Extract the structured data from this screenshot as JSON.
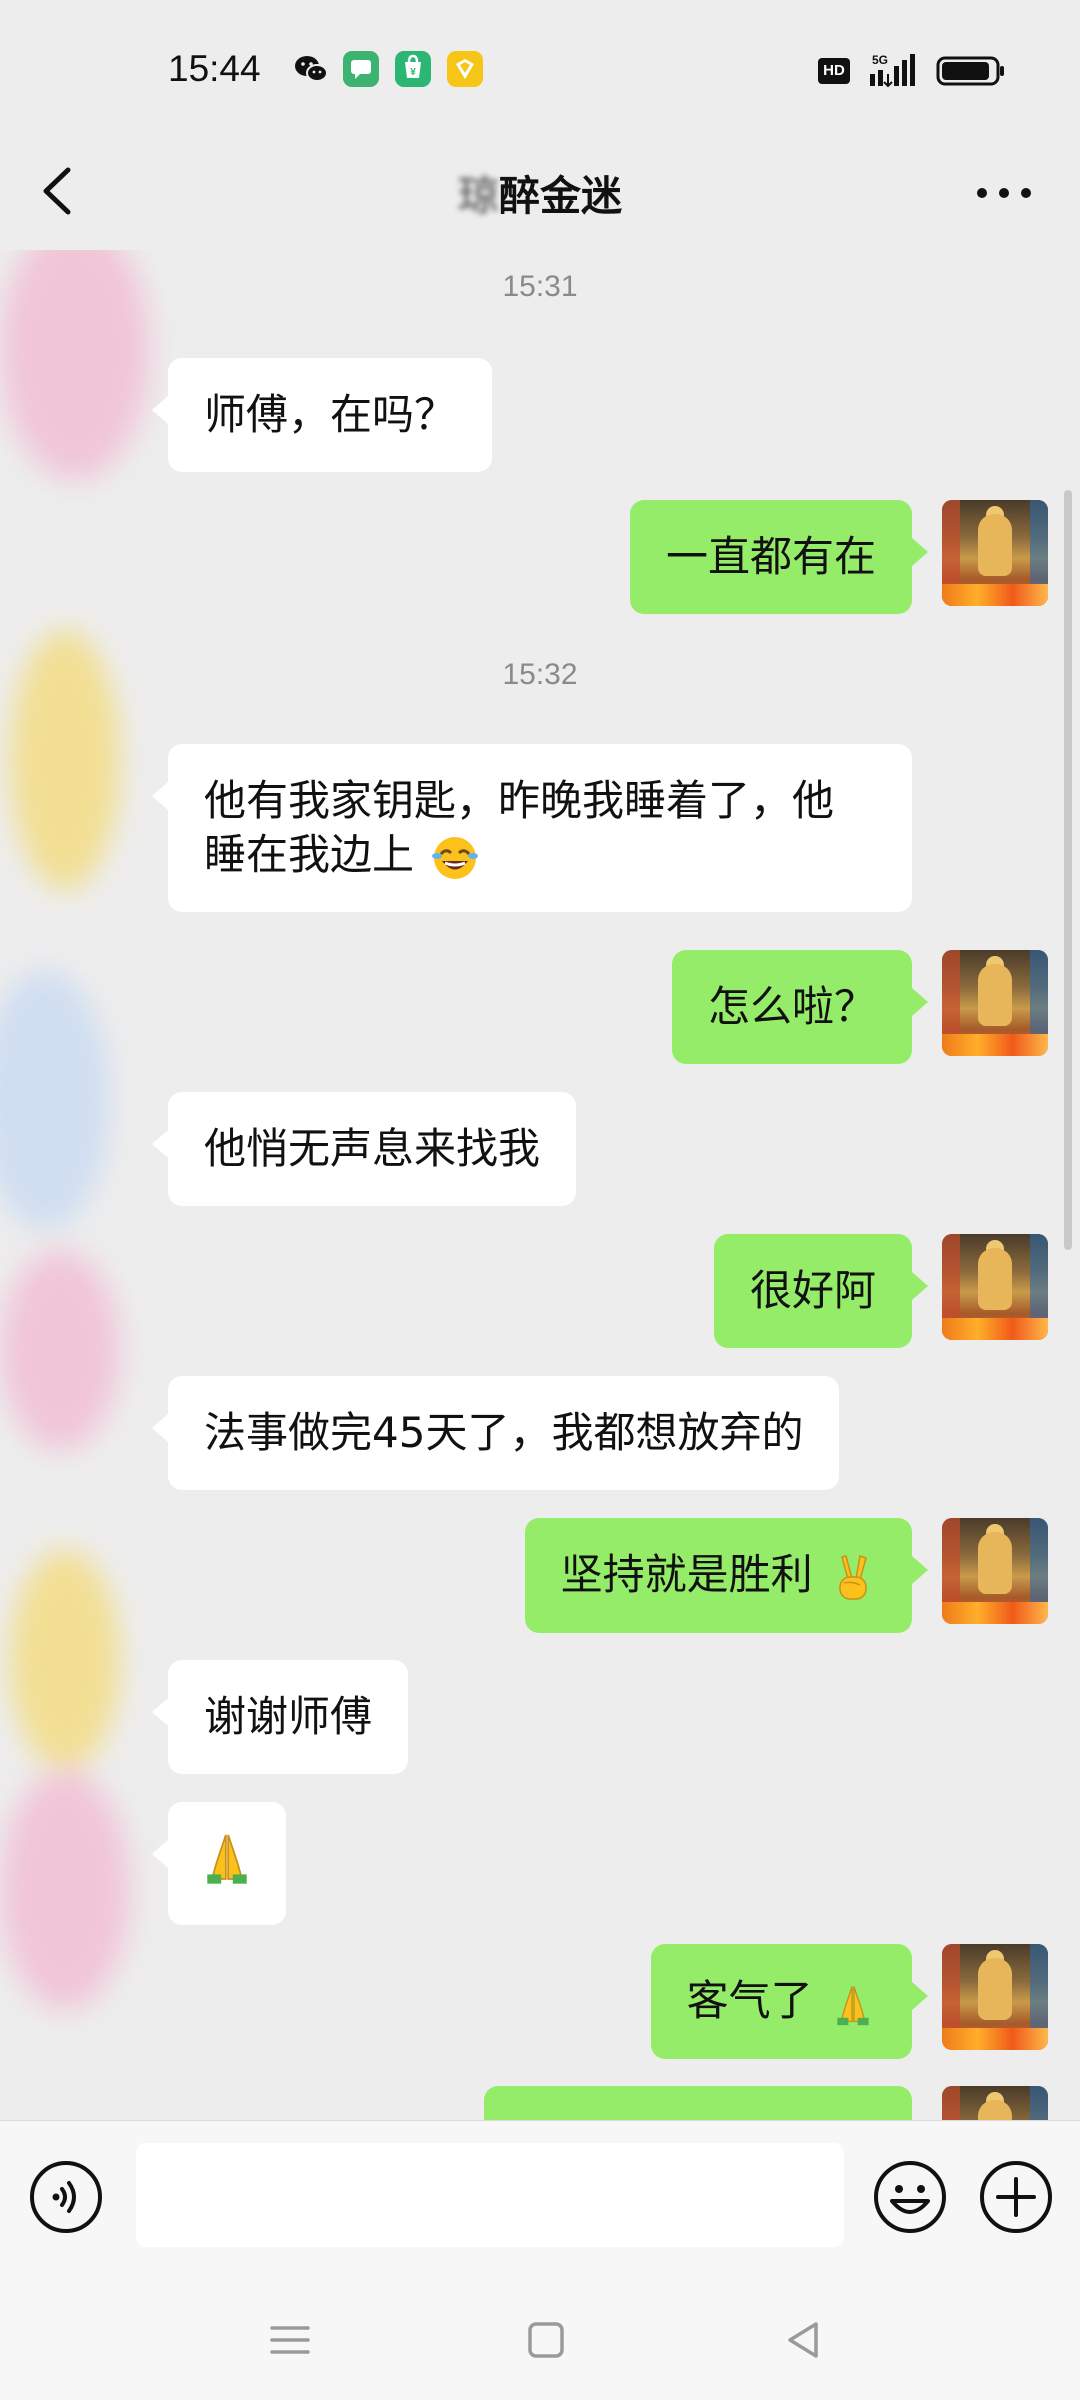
{
  "status_bar": {
    "time": "15:44",
    "app_icons": [
      "wechat-icon",
      "messages-icon",
      "shop-icon",
      "coupon-icon"
    ],
    "hd_badge": "HD",
    "network": "5G",
    "battery": 0.9
  },
  "header": {
    "title_blurred": "琼",
    "title": "醉金迷"
  },
  "messages": [
    {
      "type": "time",
      "text": "15:31"
    },
    {
      "type": "in",
      "text": "师傅，在吗？"
    },
    {
      "type": "out",
      "text": "一直都有在"
    },
    {
      "type": "time",
      "text": "15:32"
    },
    {
      "type": "in",
      "line1": "他有我家钥匙，昨晚我睡着了，他",
      "line2": "睡在我边上",
      "emoji": "laughing-crying-emoji"
    },
    {
      "type": "out",
      "text": "怎么啦？"
    },
    {
      "type": "in",
      "text": "他悄无声息来找我"
    },
    {
      "type": "out",
      "text": "很好阿"
    },
    {
      "type": "in",
      "text": "法事做完45天了，我都想放弃的"
    },
    {
      "type": "out",
      "text": "坚持就是胜利",
      "emoji": "victory-hand-emoji"
    },
    {
      "type": "in",
      "text": "谢谢师傅"
    },
    {
      "type": "in",
      "emoji": "folded-hands-emoji"
    },
    {
      "type": "out",
      "text": "客气了",
      "emoji": "folded-hands-emoji"
    },
    {
      "type": "out",
      "text": ""
    }
  ],
  "colors": {
    "background": "#ededed",
    "bubble_in": "#ffffff",
    "bubble_out": "#95ec69",
    "timestamp": "#8a8a8a"
  },
  "input": {
    "placeholder": ""
  },
  "nav": {
    "buttons": [
      "menu-icon",
      "home-icon",
      "back-triangle-icon"
    ]
  }
}
